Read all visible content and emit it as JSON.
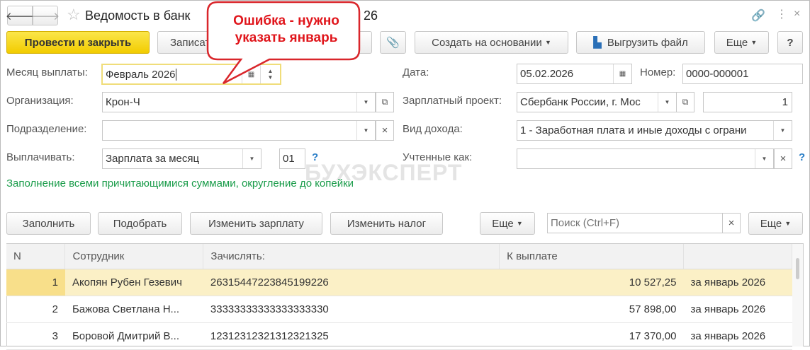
{
  "window": {
    "title": "Ведомость в банк",
    "title_tail": "26"
  },
  "callout": {
    "line1": "Ошибка - нужно",
    "line2": "указать январь",
    "color": "#e0151b"
  },
  "toolbar": {
    "post_close": "Провести и закрыть",
    "save": "Записать",
    "create_based": "Создать на основании",
    "export": "Выгрузить файл",
    "more": "Еще",
    "help": "?"
  },
  "form": {
    "month_label": "Месяц выплаты:",
    "month_value": "Февраль 2026",
    "date_label": "Дата:",
    "date_value": "05.02.2026",
    "number_label": "Номер:",
    "number_value": "0000-000001",
    "org_label": "Организация:",
    "org_value": "Крон-Ч",
    "project_label": "Зарплатный проект:",
    "project_value": "Сбербанк России, г. Мос",
    "project_num": "1",
    "dept_label": "Подразделение:",
    "dept_value": "",
    "income_label": "Вид дохода:",
    "income_value": "1 - Заработная плата и иные доходы с ограни",
    "pay_label": "Выплачивать:",
    "pay_value": "Зарплата за месяц",
    "pay_day": "01",
    "counted_label": "Учтенные как:",
    "counted_value": "",
    "help": "?",
    "fill_link": "Заполнение всеми причитающимися суммами, округление до копейки"
  },
  "watermark": "БУХЭКСПЕРТ",
  "table_toolbar": {
    "fill": "Заполнить",
    "pick": "Подобрать",
    "change_salary": "Изменить зарплату",
    "change_tax": "Изменить налог",
    "more": "Еще",
    "search_placeholder": "Поиск (Ctrl+F)",
    "more2": "Еще"
  },
  "table": {
    "headers": [
      "N",
      "Сотрудник",
      "Зачислять:",
      "К выплате",
      ""
    ],
    "rows": [
      {
        "n": "1",
        "employee": "Акопян Рубен Гезевич",
        "account": "26315447223845199226",
        "amount": "10 527,25",
        "period": "за январь 2026"
      },
      {
        "n": "2",
        "employee": "Бажова Светлана Н...",
        "account": "33333333333333333330",
        "amount": "57 898,00",
        "period": "за январь 2026"
      },
      {
        "n": "3",
        "employee": "Боровой Дмитрий В...",
        "account": "12312312321312321325",
        "amount": "17 370,00",
        "period": "за январь 2026"
      }
    ]
  }
}
